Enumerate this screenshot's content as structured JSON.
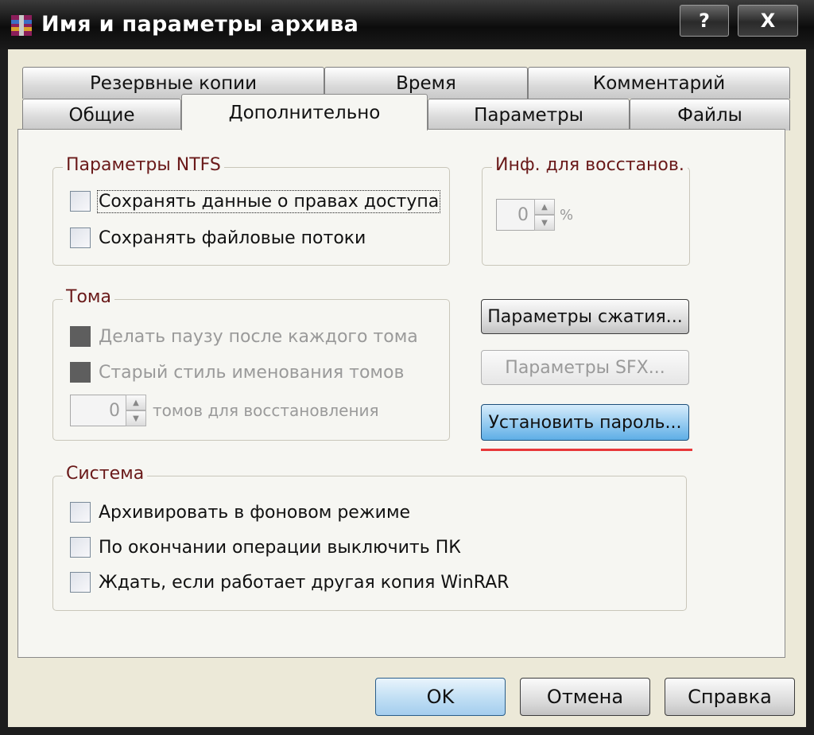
{
  "window": {
    "title": "Имя и параметры архива",
    "help_label": "?",
    "close_label": "X"
  },
  "tabs_row1": [
    {
      "label": "Резервные копии"
    },
    {
      "label": "Время"
    },
    {
      "label": "Комментарий"
    }
  ],
  "tabs_row2": [
    {
      "label": "Общие"
    },
    {
      "label": "Дополнительно"
    },
    {
      "label": "Параметры"
    },
    {
      "label": "Файлы"
    }
  ],
  "active_tab": "Дополнительно",
  "ntfs": {
    "title": "Параметры NTFS",
    "items": [
      {
        "label": "Сохранять данные о правах доступа",
        "checked": false
      },
      {
        "label": "Сохранять файловые потоки",
        "checked": false
      }
    ]
  },
  "recovery": {
    "title": "Инф. для восстанов.",
    "value": "0",
    "unit": "%"
  },
  "volumes": {
    "title": "Тома",
    "items": [
      {
        "label": "Делать паузу после каждого тома",
        "disabled": true
      },
      {
        "label": "Старый стиль именования томов",
        "disabled": true
      }
    ],
    "recovery_volumes_value": "0",
    "recovery_volumes_label": "томов для восстановления"
  },
  "buttons": {
    "compression": "Параметры сжатия...",
    "sfx": "Параметры SFX...",
    "password": "Установить пароль..."
  },
  "system": {
    "title": "Система",
    "items": [
      {
        "label": "Архивировать в фоновом режиме",
        "checked": false
      },
      {
        "label": "По окончании операции выключить ПК",
        "checked": false
      },
      {
        "label": "Ждать, если работает другая копия WinRAR",
        "checked": false
      }
    ]
  },
  "footer": {
    "ok": "OK",
    "cancel": "Отмена",
    "help": "Справка"
  },
  "colors": {
    "group_title": "#6a1a1a",
    "primary_button": "#8ec7ef",
    "highlight_underline": "#e8383a"
  }
}
